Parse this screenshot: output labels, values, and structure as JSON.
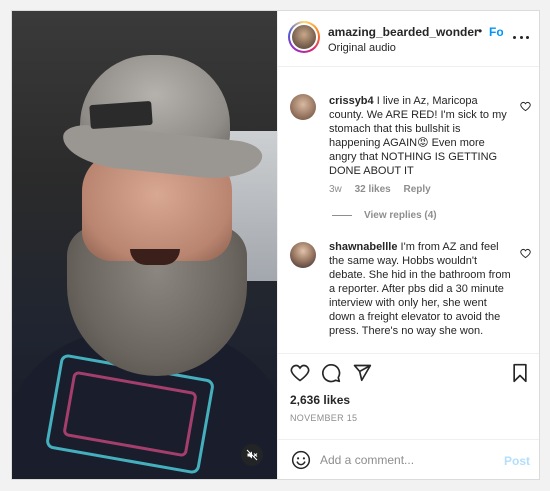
{
  "post": {
    "username": "amazing_bearded_wonder",
    "separator": "•",
    "follow_label": "Follow",
    "audio_label": "Original audio"
  },
  "comments": [
    {
      "username": "crissyb4",
      "text": "I live in Az, Maricopa county. We ARE RED! I'm sick to my stomach that this bullshit is happening AGAIN😡 Even more angry that NOTHING IS GETTING DONE ABOUT IT",
      "time": "3w",
      "likes": "32 likes",
      "reply_label": "Reply",
      "view_replies": "View replies (4)"
    },
    {
      "username": "shawnabellle",
      "text": "I'm from AZ and feel the same way. Hobbs wouldn't debate. She hid in the bathroom from a reporter. After pbs did a 30 minute interview with only her, she went down a freight elevator to avoid the press. There's no way she won."
    }
  ],
  "footer": {
    "likes": "2,636 likes",
    "date": "NOVEMBER 15",
    "comment_placeholder": "Add a comment...",
    "post_label": "Post"
  },
  "icons": {
    "more": "more-options-icon",
    "heart": "heart-icon",
    "comment": "comment-icon",
    "share": "share-icon",
    "save": "bookmark-icon",
    "emoji": "emoji-icon",
    "mute": "muted-speaker-icon"
  },
  "colors": {
    "link_blue": "#0095f6",
    "post_disabled": "#b2dffc",
    "secondary_text": "#8e8e8e"
  }
}
